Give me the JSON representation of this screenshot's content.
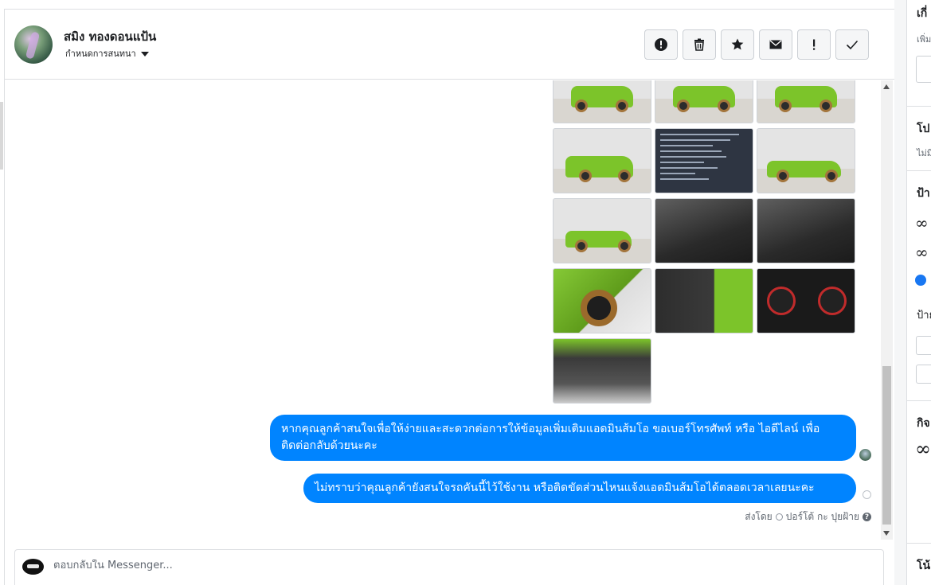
{
  "header": {
    "contact_name": "สมิง ทองดอนแป้น",
    "subtitle": "กำหนดการสนทนา"
  },
  "toolbar": {
    "buttons": [
      {
        "icon": "alert-circle-icon"
      },
      {
        "icon": "trash-icon"
      },
      {
        "icon": "star-icon"
      },
      {
        "icon": "envelope-icon"
      },
      {
        "icon": "exclamation-icon"
      },
      {
        "icon": "checkmark-icon"
      }
    ]
  },
  "messages": {
    "bubble_1": "หากคุณลูกค้าสนใจเพื่อให้ง่ายและสะดวกต่อการให้ข้อมูลเพิ่มเติมแอดมินส้มโอ ขอเบอร์โทรศัพท์ หรือ ไอดีไลน์ เพื่อติดต่อกลับด้วยนะคะ",
    "bubble_2": "ไม่ทราบว่าคุณลูกค้ายังสนใจรถคันนี้ไว้ใช้งาน หรือติดขัดส่วนไหนแจ้งแอดมินส้มโอได้ตลอดเวลาเลยนะคะ",
    "sent_by_label": "ส่งโดย",
    "sent_by_name": "ปอร์โต้ กะ ปุยฝ้าย"
  },
  "composer": {
    "placeholder": "ตอบกลับใน Messenger..."
  },
  "sidebar": {
    "section_1_title": "เกี่",
    "section_1_sub": "เพิ่ม",
    "section_2_title": "โป",
    "section_2_sub": "ไม่มี",
    "section_3_title": "ป้า",
    "section_3_sub": "ป้าย",
    "section_4_title": "กิจ",
    "section_5_title": "โน้"
  },
  "colors": {
    "bubble": "#0084ff",
    "accent": "#1877f2"
  }
}
